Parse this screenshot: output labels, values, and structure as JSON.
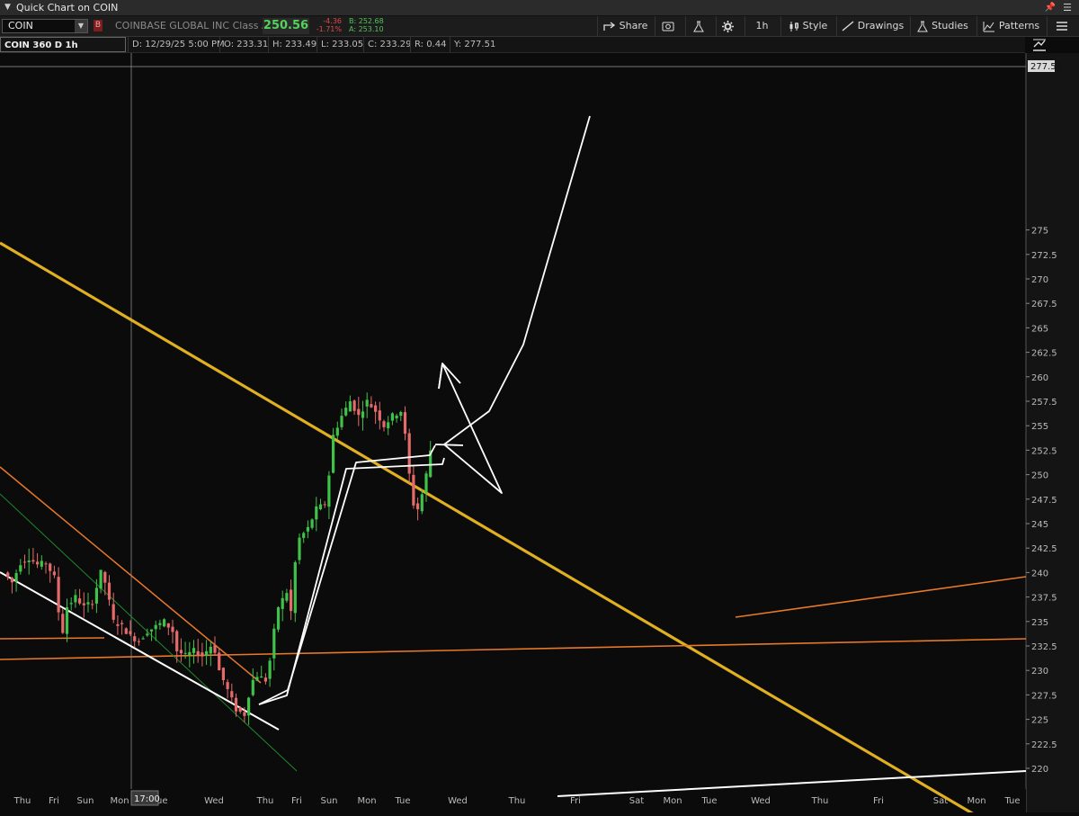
{
  "window": {
    "title": "Quick Chart on COIN"
  },
  "toolbar": {
    "symbol": "COIN",
    "company": "COINBASE GLOBAL INC Class A",
    "last": "250.56",
    "change": "-4.36",
    "change_pct": "-1.71%",
    "bid": "B: 252.68",
    "ask": "A: 253.10",
    "share_label": "Share",
    "interval_label": "1h",
    "style_label": "Style",
    "drawings_label": "Drawings",
    "studies_label": "Studies",
    "patterns_label": "Patterns",
    "flag_label": "B"
  },
  "info": {
    "symbol_desc": "COIN 360 D 1h [NASDAQ]",
    "date": "D: 12/29/25 5:00 PM",
    "open": "O: 233.31",
    "high": "H: 233.49",
    "low": "L: 233.05",
    "close": "C: 233.29",
    "range": "R: 0.44",
    "y": "Y: 277.51"
  },
  "colors": {
    "up": "#3fc24a",
    "down": "#e56b6b",
    "trend_gold": "#e0b020",
    "trend_orange": "#e8782a",
    "trend_green": "#1e8a2a",
    "drawing_white": "#ffffff"
  },
  "chart_data": {
    "type": "candlestick",
    "ylim": [
      218,
      278
    ],
    "y_ticks": [
      220,
      222.5,
      225,
      227.5,
      230,
      232.5,
      235,
      237.5,
      240,
      242.5,
      245,
      247.5,
      250,
      252.5,
      255,
      257.5,
      260,
      262.5,
      265,
      267.5,
      270,
      272.5,
      275
    ],
    "cursor_price": "277.51",
    "cursor_time": "17:00",
    "x_labels": [
      "Thu",
      "Fri",
      "Sun",
      "Mon",
      "Tue",
      "Wed",
      "Thu",
      "Fri",
      "Sun",
      "Mon",
      "Tue",
      "Wed",
      "Thu",
      "Fri",
      "Sat",
      "Mon",
      "Tue",
      "Wed",
      "Thu",
      "Fri",
      "Sat",
      "Mon",
      "Tue"
    ],
    "price_path": [
      [
        0,
        240
      ],
      [
        2,
        239
      ],
      [
        4,
        241
      ],
      [
        6,
        241.5
      ],
      [
        8,
        240.8
      ],
      [
        10,
        241
      ],
      [
        12,
        239.5
      ],
      [
        13,
        236
      ],
      [
        14,
        234
      ],
      [
        15,
        236.5
      ],
      [
        17,
        237.5
      ],
      [
        19,
        236.5
      ],
      [
        21,
        237
      ],
      [
        22,
        238.5
      ],
      [
        23,
        240
      ],
      [
        24,
        239
      ],
      [
        25,
        237
      ],
      [
        26,
        235
      ],
      [
        28,
        234.5
      ],
      [
        30,
        233.5
      ],
      [
        32,
        233
      ],
      [
        34,
        234
      ],
      [
        36,
        234.5
      ],
      [
        38,
        235
      ],
      [
        40,
        234
      ],
      [
        41,
        232
      ],
      [
        43,
        231.5
      ],
      [
        45,
        232
      ],
      [
        47,
        231.5
      ],
      [
        49,
        232.5
      ],
      [
        50,
        232
      ],
      [
        51,
        230
      ],
      [
        53,
        228
      ],
      [
        55,
        226
      ],
      [
        57,
        225.5
      ],
      [
        58,
        227.5
      ],
      [
        59,
        229
      ],
      [
        60,
        229.5
      ],
      [
        62,
        229
      ],
      [
        63,
        231
      ],
      [
        64,
        234
      ],
      [
        65,
        236.5
      ],
      [
        67,
        238
      ],
      [
        68,
        236
      ],
      [
        69,
        241
      ],
      [
        70,
        243.5
      ],
      [
        72,
        244.5
      ],
      [
        74,
        246.5
      ],
      [
        76,
        247
      ],
      [
        77,
        250
      ],
      [
        78,
        254
      ],
      [
        80,
        256
      ],
      [
        82,
        257.5
      ],
      [
        84,
        256
      ],
      [
        86,
        257.5
      ],
      [
        88,
        256.5
      ],
      [
        90,
        255
      ],
      [
        92,
        256
      ],
      [
        94,
        256.5
      ],
      [
        95,
        254
      ],
      [
        96,
        250
      ],
      [
        97,
        247
      ],
      [
        98,
        246.5
      ],
      [
        99,
        248
      ],
      [
        100,
        250
      ],
      [
        101,
        252.5
      ]
    ]
  }
}
